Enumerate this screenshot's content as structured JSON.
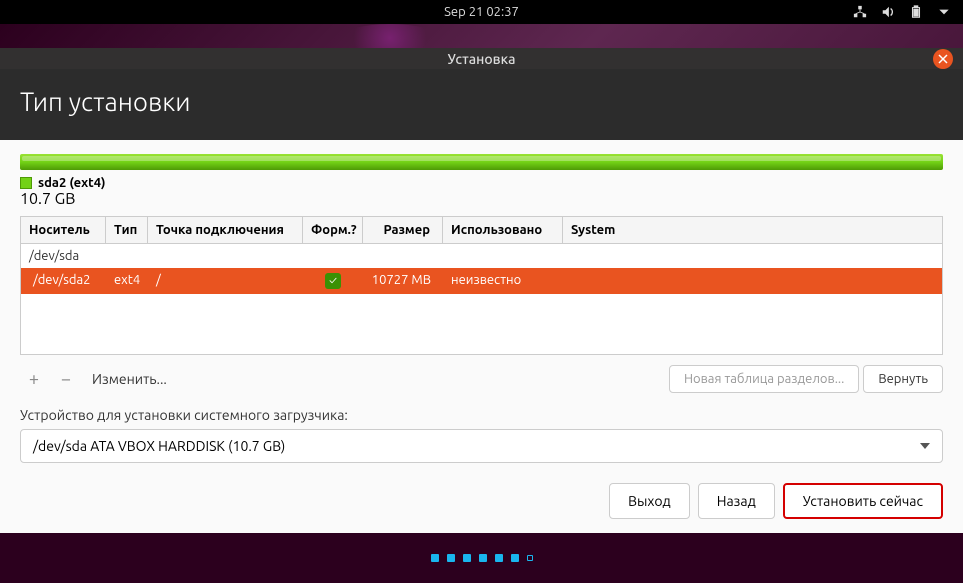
{
  "topbar": {
    "datetime": "Sep 21  02:37"
  },
  "window": {
    "title": "Установка"
  },
  "header": {
    "title": "Тип установки"
  },
  "partition_visual": {
    "name": "sda2 (ext4)",
    "size": "10.7 GB"
  },
  "table": {
    "headers": {
      "device": "Носитель",
      "type": "Тип",
      "mount": "Точка подключения",
      "format": "Форм.?",
      "size": "Размер",
      "used": "Использовано",
      "system": "System"
    },
    "rows": [
      {
        "device": "/dev/sda",
        "type": "",
        "mount": "",
        "format": "",
        "size": "",
        "used": "",
        "system": ""
      },
      {
        "device": "/dev/sda2",
        "type": "ext4",
        "mount": "/",
        "format": "check",
        "size": "10727 MB",
        "used": "неизвестно",
        "system": ""
      }
    ]
  },
  "toolbar": {
    "add": "+",
    "remove": "−",
    "change": "Изменить...",
    "new_table": "Новая таблица разделов...",
    "revert": "Вернуть"
  },
  "bootloader": {
    "label": "Устройство для установки системного загрузчика:",
    "value": "/dev/sda   ATA VBOX HARDDISK (10.7 GB)"
  },
  "nav": {
    "quit": "Выход",
    "back": "Назад",
    "install": "Установить сейчас"
  }
}
